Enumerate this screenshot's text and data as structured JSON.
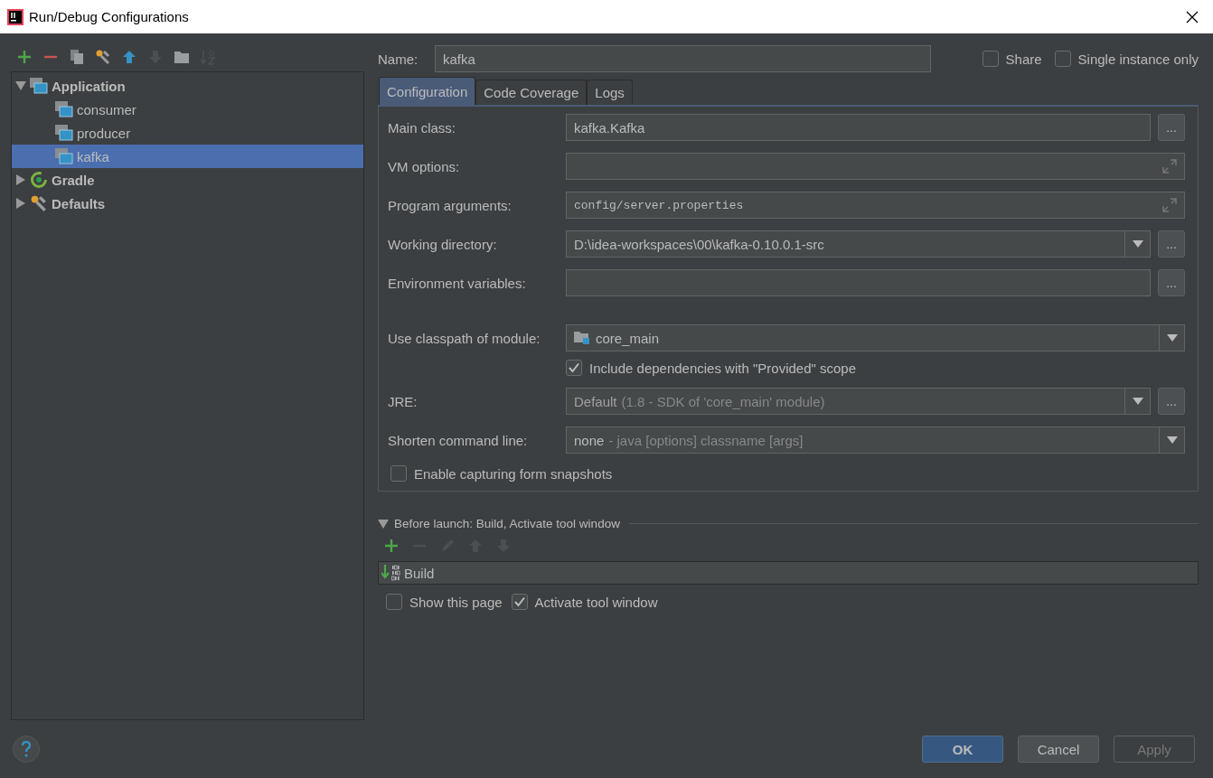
{
  "window": {
    "title": "Run/Debug Configurations"
  },
  "toolbar": [
    {
      "kind": "add",
      "disabled": false
    },
    {
      "kind": "remove",
      "disabled": false
    },
    {
      "kind": "copy",
      "disabled": false
    },
    {
      "kind": "wrench",
      "disabled": false
    },
    {
      "kind": "up",
      "disabled": false
    },
    {
      "kind": "down",
      "disabled": true
    },
    {
      "kind": "folder",
      "disabled": false
    },
    {
      "kind": "sort",
      "disabled": true
    }
  ],
  "tree": [
    {
      "label": "Application",
      "kind": "application",
      "expanded": true,
      "selected": false,
      "children": [
        {
          "label": "consumer",
          "selected": false
        },
        {
          "label": "producer",
          "selected": false
        },
        {
          "label": "kafka",
          "selected": true
        }
      ]
    },
    {
      "label": "Gradle",
      "kind": "gradle",
      "expanded": false,
      "selected": false
    },
    {
      "label": "Defaults",
      "kind": "defaults",
      "expanded": false,
      "selected": false
    }
  ],
  "name": {
    "label": "Name:",
    "value": "kafka"
  },
  "options": [
    {
      "label": "Share",
      "checked": false
    },
    {
      "label": "Single instance only",
      "checked": false
    }
  ],
  "tabs": [
    {
      "label": "Configuration",
      "selected": true
    },
    {
      "label": "Code Coverage",
      "selected": false
    },
    {
      "label": "Logs",
      "selected": false
    }
  ],
  "fields": [
    {
      "kind": "text",
      "label": "Main class:",
      "value": "kafka.Kafka",
      "browse": "..."
    },
    {
      "kind": "expand",
      "label": "VM options:"
    },
    {
      "kind": "expand",
      "label": "Program arguments:",
      "value": "config/server.properties"
    },
    {
      "kind": "combo",
      "label": "Working directory:",
      "value": "D:\\idea-workspaces\\00\\kafka-0.10.0.1-src",
      "browse": "..."
    },
    {
      "kind": "text",
      "label": "Environment variables:",
      "browse": "..."
    },
    {
      "kind": "module",
      "label": "Use classpath of module:",
      "value": "core_main"
    },
    {
      "kind": "check",
      "label": "Include dependencies with \"Provided\" scope",
      "checked": true
    },
    {
      "kind": "combo",
      "label": "JRE:",
      "value": "Default",
      "hint": "(1.8 - SDK of 'core_main' module)",
      "browse": "...",
      "disabled": true
    },
    {
      "kind": "combo",
      "label": "Shorten command line:",
      "value": "none",
      "hint": "- java [options] classname [args]"
    }
  ],
  "snapshots": {
    "label": "Enable capturing form snapshots",
    "checked": false
  },
  "before_launch": {
    "title": "Before launch: Build, Activate tool window",
    "expanded": true,
    "tools": [
      {
        "kind": "add",
        "disabled": false
      },
      {
        "kind": "remove",
        "disabled": true
      },
      {
        "kind": "edit",
        "disabled": true
      },
      {
        "kind": "up",
        "disabled": true
      },
      {
        "kind": "down",
        "disabled": true
      }
    ],
    "tasks": [
      {
        "label": "Build"
      }
    ],
    "options": [
      {
        "label": "Show this page",
        "checked": false
      },
      {
        "label": "Activate tool window",
        "checked": true
      }
    ]
  },
  "buttons": [
    {
      "label": "OK",
      "kind": "primary",
      "disabled": false
    },
    {
      "label": "Cancel",
      "kind": "normal",
      "disabled": false
    },
    {
      "label": "Apply",
      "kind": "normal",
      "disabled": true
    }
  ]
}
